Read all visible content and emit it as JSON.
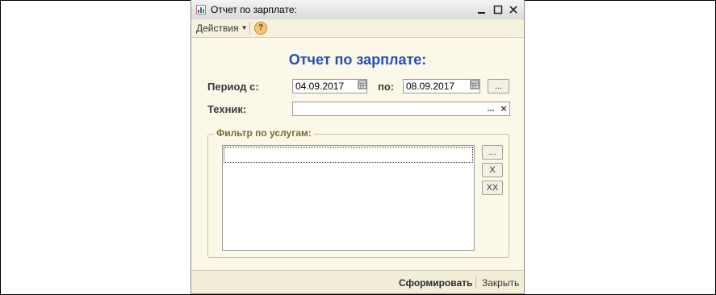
{
  "window": {
    "title": "Отчет по зарплате:"
  },
  "toolbar": {
    "actions_label": "Действия",
    "help_label": "?"
  },
  "form": {
    "heading": "Отчет по зарплате:",
    "period_from_label": "Период с:",
    "period_from_value": "04.09.2017",
    "period_to_label": "по:",
    "period_to_value": "08.09.2017",
    "period_picker_label": "...",
    "technician_label": "Техник:",
    "technician_value": "",
    "technician_select_label": "...",
    "technician_clear_label": "×"
  },
  "filter": {
    "legend": "Фильтр по услугам:",
    "add_label": "...",
    "remove_label": "X",
    "clear_label": "XX",
    "items": []
  },
  "footer": {
    "generate_label": "Сформировать",
    "close_label": "Закрыть"
  },
  "colors": {
    "window_bg": "#fbf8e8",
    "heading": "#2450b4",
    "legend": "#7b6b2b"
  }
}
